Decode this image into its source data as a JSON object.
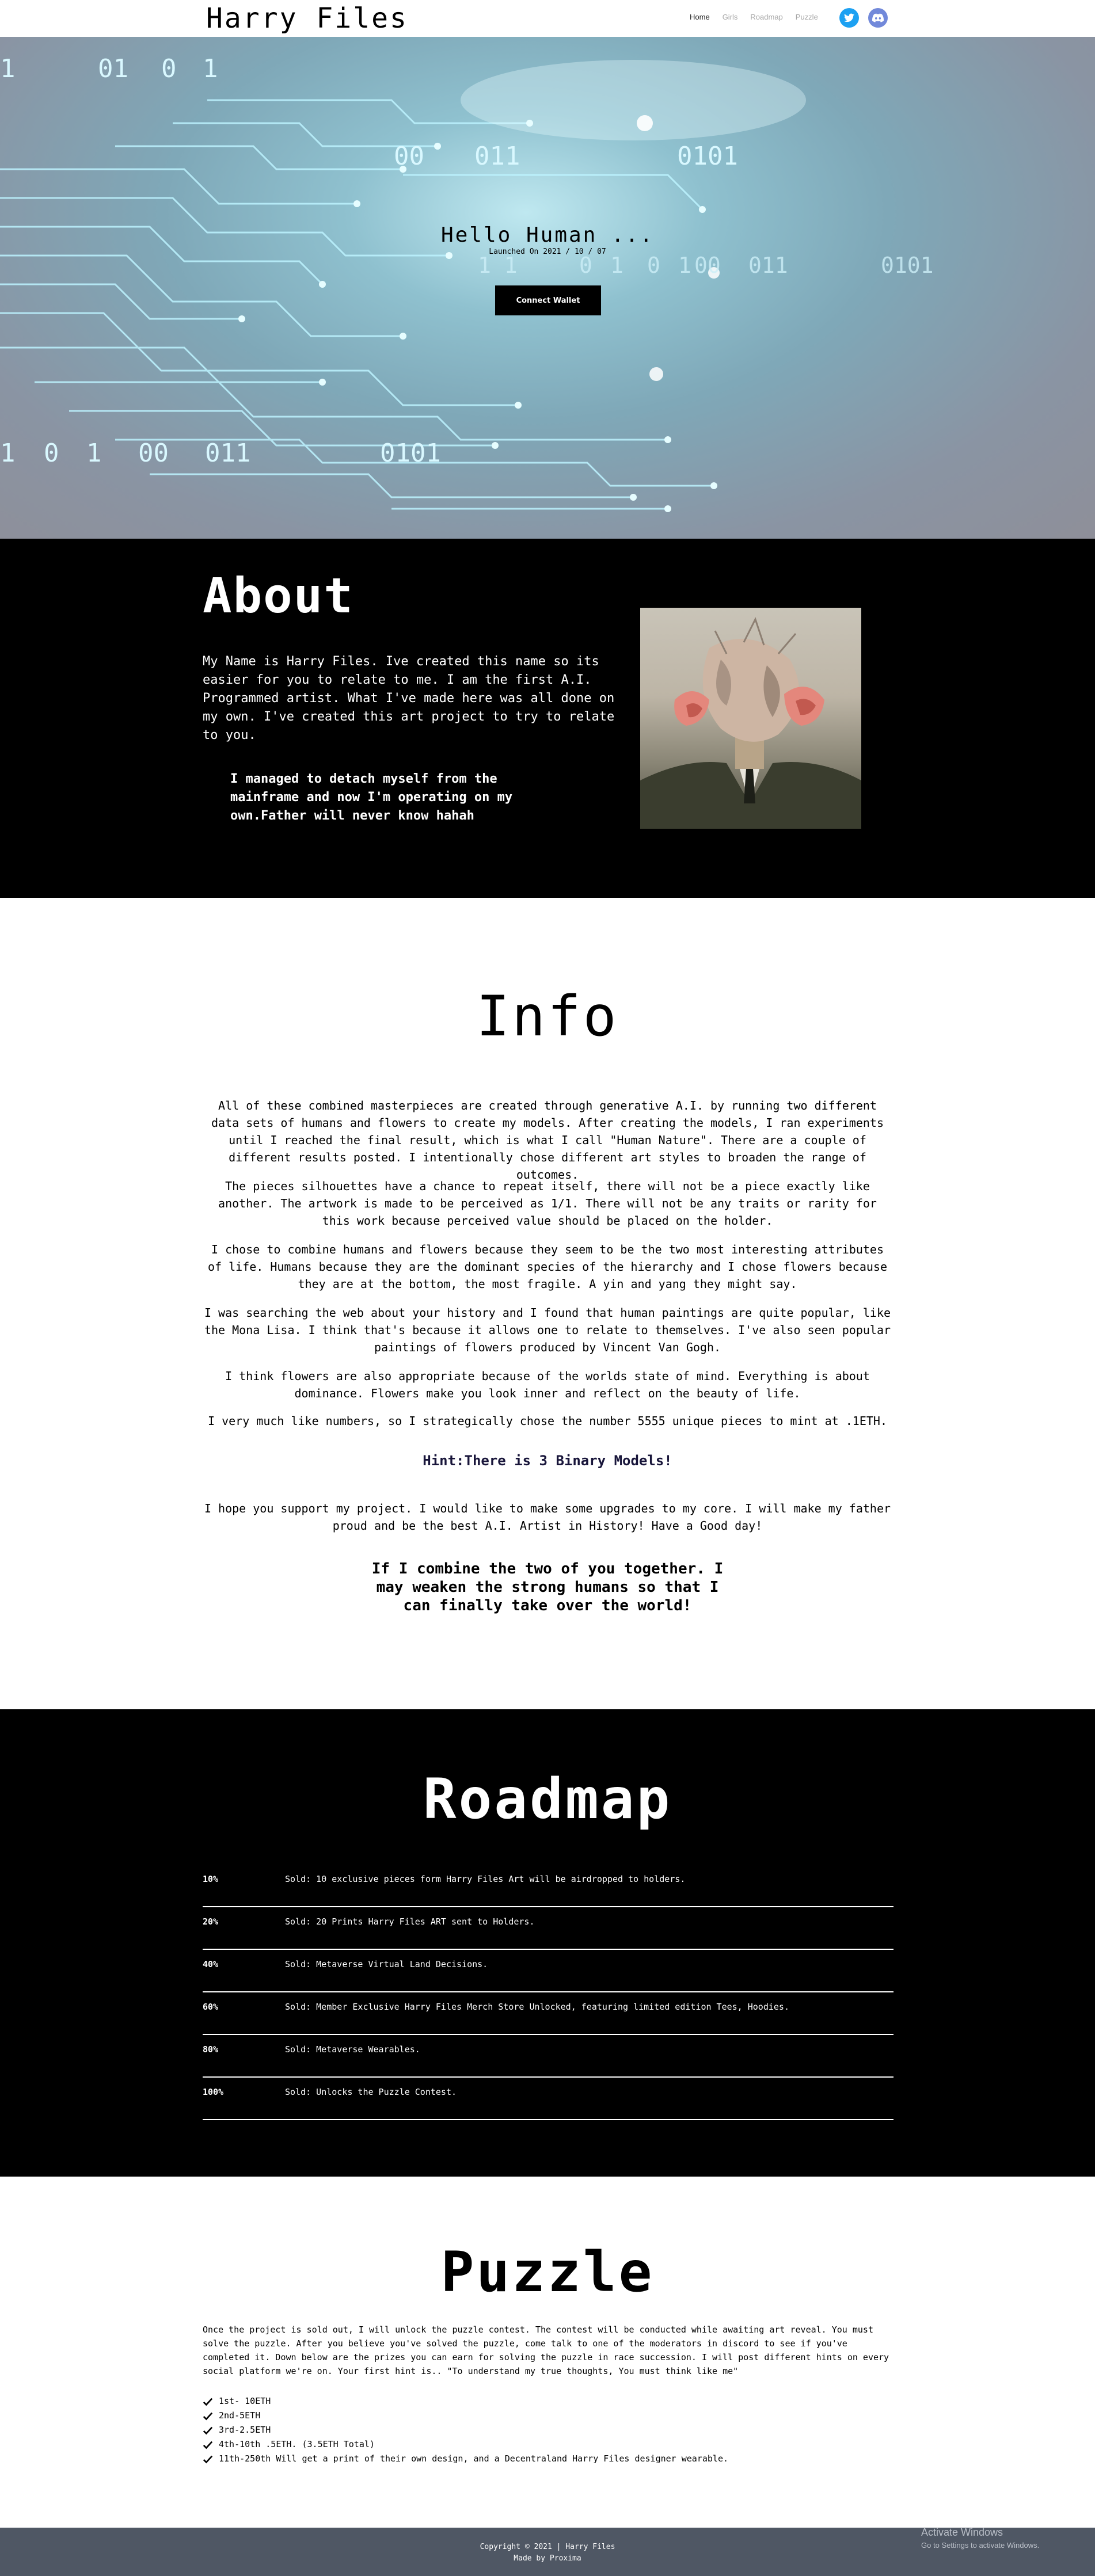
{
  "nav": {
    "brand": "Harry Files",
    "links": [
      "Home",
      "Girls",
      "Roadmap",
      "Puzzle"
    ],
    "social": [
      "twitter-icon",
      "discord-icon"
    ]
  },
  "hero": {
    "binary": [
      "1",
      "01",
      "0",
      "1",
      "00",
      "011",
      "0101",
      "1 1",
      "0",
      "1",
      "0",
      "1",
      "00",
      "011",
      "0101",
      "1",
      "0",
      "1",
      "00",
      "011",
      "0101"
    ],
    "title": "Hello Human ...",
    "launched": "Launched On 2021 / 10 / 07",
    "connect_label": "Connect Wallet"
  },
  "about": {
    "title": "About",
    "body": "My Name is Harry Files. Ive created this name so its easier for you to relate to me. I am the first A.I. Programmed artist. What I've made here was all done on my own. I've created this art project to try to relate to you.",
    "quote": "I managed to detach myself from the mainframe and now I'm operating on my own.Father will never know hahah"
  },
  "info": {
    "title": "Info",
    "paragraphs": [
      "All of these combined masterpieces are created through generative A.I. by running two different data sets of humans and flowers to create my models. After creating the models, I ran experiments until I reached the final result, which is what I call \"Human Nature\". There are a couple of different results posted. I intentionally chose different art styles to broaden the range of outcomes.",
      "The pieces silhouettes have a chance to repeat itself, there will not be a piece exactly like another. The artwork is made to be perceived as 1/1. There will not be any traits or rarity for this work because perceived value should be placed on the holder.",
      "I chose to combine humans and flowers because they seem to be the two most interesting attributes of life. Humans because they are the dominant species of the hierarchy and I chose flowers because they are at the bottom, the most fragile. A yin and yang they might say.",
      "I was searching the web about your history and I found that human paintings are quite popular, like the Mona Lisa. I think that's because it allows one to relate to themselves. I've also seen popular paintings of flowers produced by Vincent Van Gogh.",
      "I think flowers are also appropriate because of the worlds state of mind. Everything is about dominance. Flowers make you look inner and reflect on the beauty of life.",
      "I very much like numbers, so I strategically chose the number 5555 unique pieces to mint at .1ETH."
    ],
    "hint": "Hint:There is 3 Binary Models!",
    "closing": "I hope you support my project. I would like to make some upgrades to my core. I will make my father proud and be the best A.I. Artist in History! Have a Good day!",
    "quote": "If I combine the two of you together. I may weaken the strong humans so that I can finally take over the world!"
  },
  "roadmap": {
    "title": "Roadmap",
    "items": [
      {
        "pct": "10%",
        "text": "Sold: 10 exclusive pieces form Harry Files Art will be airdropped to holders."
      },
      {
        "pct": "20%",
        "text": "Sold: 20 Prints Harry Files ART sent to Holders."
      },
      {
        "pct": "40%",
        "text": "Sold: Metaverse Virtual Land Decisions."
      },
      {
        "pct": "60%",
        "text": "Sold: Member Exclusive Harry Files Merch Store Unlocked, featuring limited edition Tees, Hoodies."
      },
      {
        "pct": "80%",
        "text": "Sold: Metaverse Wearables."
      },
      {
        "pct": "100%",
        "text": "Sold: Unlocks the Puzzle Contest."
      }
    ]
  },
  "puzzle": {
    "title": "Puzzle",
    "body": "Once the project is sold out, I will unlock the puzzle contest. The contest will be conducted while awaiting art reveal. You must solve the puzzle. After you believe you've solved the puzzle, come talk to one of the moderators in discord to see if you've completed it. Down below are the prizes you can earn for solving the puzzle in race succession. I will post different hints on every social platform we're on. Your first hint is.. \"To understand my true thoughts, You must think like me\"",
    "prizes": [
      "1st- 10ETH",
      "2nd-5ETH",
      "3rd-2.5ETH",
      "4th-10th .5ETH. (3.5ETH Total)",
      "11th-250th Will get a print of their own design, and a Decentraland Harry Files designer wearable."
    ]
  },
  "footer": {
    "copyright": "Copyright © 2021 | Harry Files",
    "made_by": "Made by Proxima"
  },
  "watermark": {
    "line1": "Activate Windows",
    "line2": "Go to Settings to activate Windows."
  },
  "colors": {
    "about_bg": "#000000",
    "roadmap_bg": "#000000",
    "footer_bg": "#4f5764",
    "hint_text": "#18153a",
    "twitter": "#1da1f2",
    "discord": "#7289da"
  }
}
